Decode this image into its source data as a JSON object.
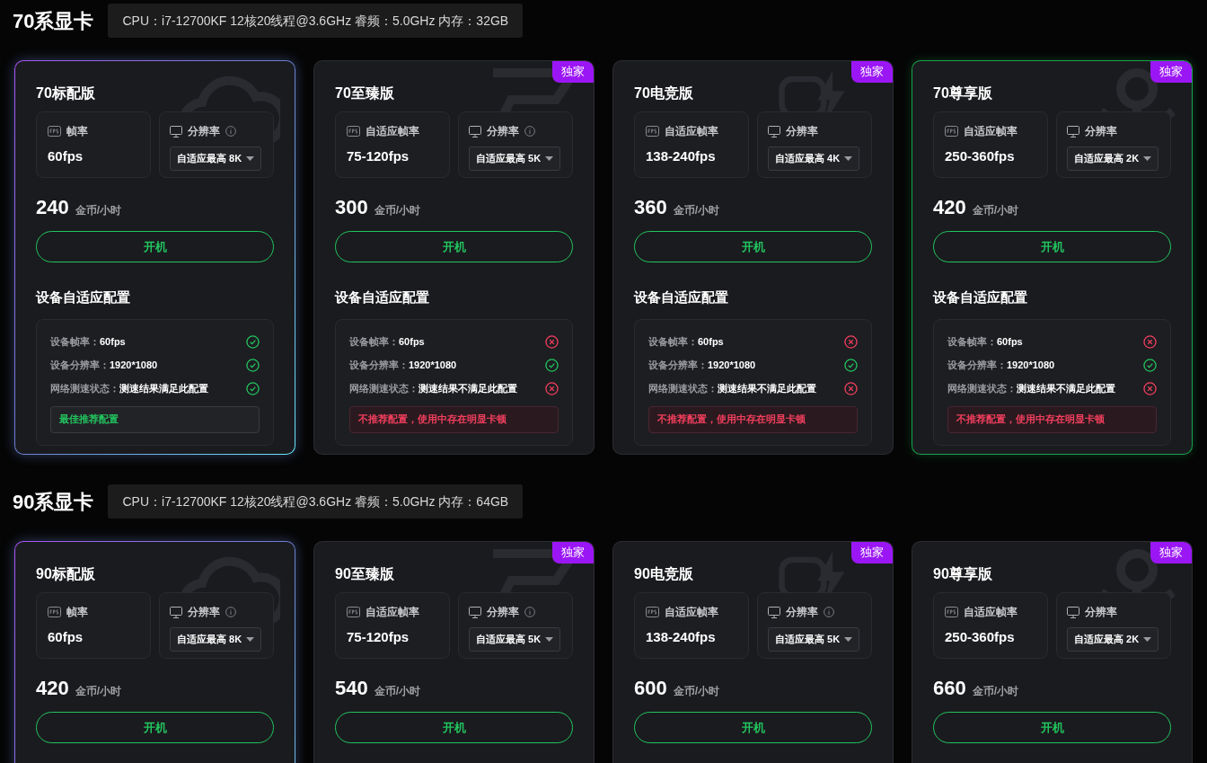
{
  "sections": [
    {
      "title": "70系显卡",
      "specs": "CPU：i7-12700KF 12核20线程@3.6GHz 睿频：5.0GHz 内存：32GB",
      "cards": [
        {
          "name": "70标配版",
          "kind": "basic",
          "selected": false,
          "fps_label": "帧率",
          "fps": "60fps",
          "res_label": "分辨率",
          "info": true,
          "res_value": "自适应最高 8K",
          "price": "240",
          "unit": "金币/小时",
          "button": "开机",
          "config_title": "设备自适应配置",
          "checks": [
            {
              "label": "设备帧率：",
              "value": "60fps",
              "ok": true
            },
            {
              "label": "设备分辨率：",
              "value": "1920*1080",
              "ok": true
            },
            {
              "label": "网络测速状态：",
              "value": "测速结果满足此配置",
              "ok": true
            }
          ],
          "verdict": {
            "text": "最佳推荐配置",
            "ok": true
          }
        },
        {
          "name": "70至臻版",
          "badge": "独家",
          "kind": "premium",
          "selected": false,
          "fps_label": "自适应帧率",
          "fps": "75-120fps",
          "res_label": "分辨率",
          "info": true,
          "res_value": "自适应最高 5K",
          "price": "300",
          "unit": "金币/小时",
          "button": "开机",
          "config_title": "设备自适应配置",
          "checks": [
            {
              "label": "设备帧率：",
              "value": "60fps",
              "ok": false
            },
            {
              "label": "设备分辨率：",
              "value": "1920*1080",
              "ok": true
            },
            {
              "label": "网络测速状态：",
              "value": "测速结果不满足此配置",
              "ok": false
            }
          ],
          "verdict": {
            "text": "不推荐配置，使用中存在明显卡顿",
            "ok": false
          }
        },
        {
          "name": "70电竞版",
          "badge": "独家",
          "kind": "esports",
          "selected": false,
          "fps_label": "自适应帧率",
          "fps": "138-240fps",
          "res_label": "分辨率",
          "info": false,
          "res_value": "自适应最高 4K",
          "price": "360",
          "unit": "金币/小时",
          "button": "开机",
          "config_title": "设备自适应配置",
          "checks": [
            {
              "label": "设备帧率：",
              "value": "60fps",
              "ok": false
            },
            {
              "label": "设备分辨率：",
              "value": "1920*1080",
              "ok": true
            },
            {
              "label": "网络测速状态：",
              "value": "测速结果不满足此配置",
              "ok": false
            }
          ],
          "verdict": {
            "text": "不推荐配置，使用中存在明显卡顿",
            "ok": false
          }
        },
        {
          "name": "70尊享版",
          "badge": "独家",
          "kind": "elite",
          "selected": true,
          "fps_label": "自适应帧率",
          "fps": "250-360fps",
          "res_label": "分辨率",
          "info": false,
          "res_value": "自适应最高 2K",
          "price": "420",
          "unit": "金币/小时",
          "button": "开机",
          "config_title": "设备自适应配置",
          "checks": [
            {
              "label": "设备帧率：",
              "value": "60fps",
              "ok": false
            },
            {
              "label": "设备分辨率：",
              "value": "1920*1080",
              "ok": true
            },
            {
              "label": "网络测速状态：",
              "value": "测速结果不满足此配置",
              "ok": false
            }
          ],
          "verdict": {
            "text": "不推荐配置，使用中存在明显卡顿",
            "ok": false
          }
        }
      ]
    },
    {
      "title": "90系显卡",
      "specs": "CPU：i7-12700KF 12核20线程@3.6GHz 睿频：5.0GHz 内存：64GB",
      "cards": [
        {
          "name": "90标配版",
          "kind": "basic",
          "selected": false,
          "fps_label": "帧率",
          "fps": "60fps",
          "res_label": "分辨率",
          "info": true,
          "res_value": "自适应最高 8K",
          "price": "420",
          "unit": "金币/小时",
          "button": "开机"
        },
        {
          "name": "90至臻版",
          "badge": "独家",
          "kind": "premium",
          "selected": false,
          "fps_label": "自适应帧率",
          "fps": "75-120fps",
          "res_label": "分辨率",
          "info": true,
          "res_value": "自适应最高 5K",
          "price": "540",
          "unit": "金币/小时",
          "button": "开机"
        },
        {
          "name": "90电竞版",
          "badge": "独家",
          "kind": "esports",
          "selected": false,
          "fps_label": "自适应帧率",
          "fps": "138-240fps",
          "res_label": "分辨率",
          "info": true,
          "res_value": "自适应最高 5K",
          "price": "600",
          "unit": "金币/小时",
          "button": "开机"
        },
        {
          "name": "90尊享版",
          "badge": "独家",
          "kind": "elite",
          "selected": false,
          "fps_label": "自适应帧率",
          "fps": "250-360fps",
          "res_label": "分辨率",
          "info": false,
          "res_value": "自适应最高 2K",
          "price": "660",
          "unit": "金币/小时",
          "button": "开机"
        }
      ]
    }
  ]
}
